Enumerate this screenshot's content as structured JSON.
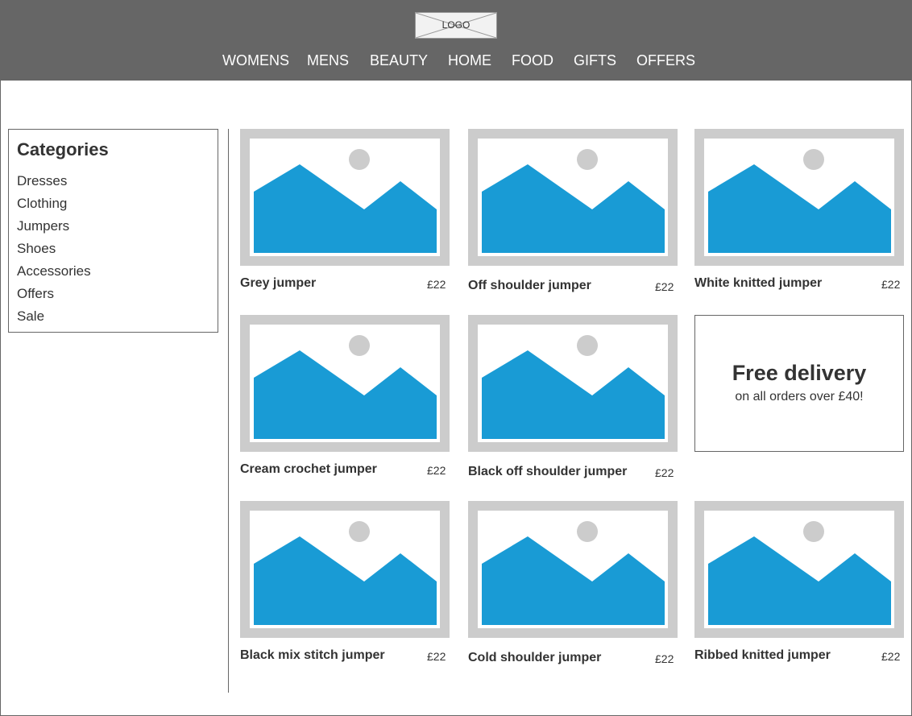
{
  "header": {
    "logo_text": "LOGO",
    "nav": [
      "WOMENS",
      "MENS",
      "BEAUTY",
      "HOME",
      "FOOD",
      "GIFTS",
      "OFFERS"
    ]
  },
  "sidebar": {
    "title": "Categories",
    "items": [
      "Dresses",
      "Clothing",
      "Jumpers",
      "Shoes",
      "Accessories",
      "Offers",
      "Sale"
    ]
  },
  "products": [
    {
      "name": "Grey jumper",
      "price": "£22"
    },
    {
      "name": "Off shoulder jumper",
      "price": "£22"
    },
    {
      "name": "White knitted jumper",
      "price": "£22"
    },
    {
      "name": "Cream crochet jumper",
      "price": "£22"
    },
    {
      "name": "Black off shoulder jumper",
      "price": "£22"
    },
    {
      "name": "Black mix stitch jumper",
      "price": "£22"
    },
    {
      "name": "Cold shoulder jumper",
      "price": "£22"
    },
    {
      "name": "Ribbed knitted jumper",
      "price": "£22"
    }
  ],
  "promo": {
    "title": "Free delivery",
    "subtitle": "on all orders over £40!"
  },
  "colors": {
    "header_bg": "#666666",
    "placeholder_frame": "#cccccc",
    "placeholder_image": "#199bd5",
    "text": "#333333"
  },
  "icons": {
    "logo": "logo-placeholder-icon",
    "product_image": "image-placeholder-icon"
  }
}
